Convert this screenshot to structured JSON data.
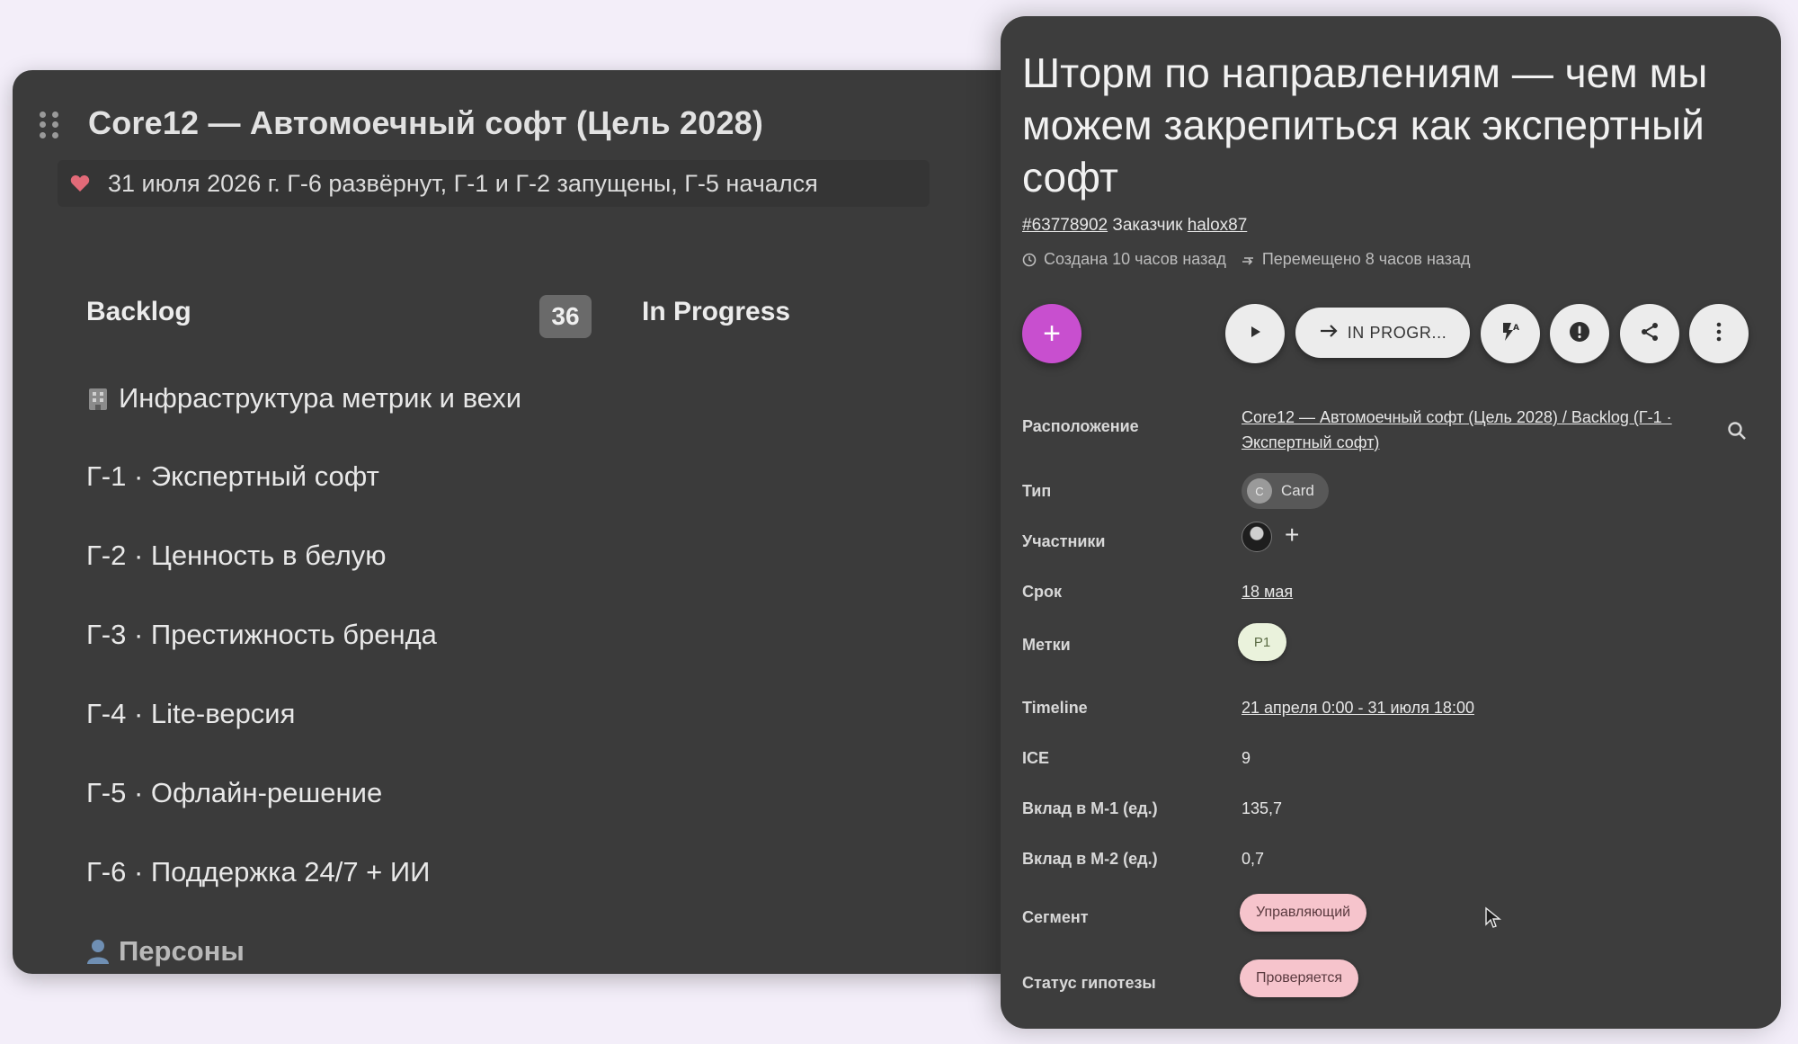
{
  "board": {
    "title": "Core12 — Автомоечный софт (Цель 2028)",
    "status_text": "31 июля 2026 г. Г-6 развёрнут, Г-1 и Г-2 запущены, Г-5 начался",
    "columns": [
      {
        "label": "Backlog",
        "count": "36"
      },
      {
        "label": "In Progress"
      }
    ],
    "items": [
      {
        "label": "Инфраструктура метрик и вехи",
        "icon": "building-icon"
      },
      {
        "label": "Г-1 · Экспертный софт"
      },
      {
        "label": "Г-2 · Ценность в белую"
      },
      {
        "label": "Г-3 · Престижность бренда"
      },
      {
        "label": "Г-4 · Lite-версия"
      },
      {
        "label": "Г-5 · Офлайн-решение"
      },
      {
        "label": "Г-6 · Поддержка 24/7 + ИИ"
      },
      {
        "label": "Персоны",
        "icon": "person-icon"
      }
    ]
  },
  "card": {
    "title": "Шторм по направлениям — чем мы можем закрепиться как экспертный софт",
    "id": "#63778902",
    "customer_label": "Заказчик",
    "customer": "halox87",
    "created": "Создана 10 часов назад",
    "moved": "Перемещено 8 часов назад",
    "actions": {
      "add": "+",
      "move_label": "IN PROGR...",
      "icons": [
        "play-icon",
        "arrow-right-icon",
        "flash-auto-icon",
        "alert-icon",
        "share-icon",
        "more-vertical-icon"
      ]
    },
    "properties": {
      "location_label": "Расположение",
      "location": "Core12 — Автомоечный софт (Цель 2028) / Backlog (Г-1 · Экспертный софт)",
      "type_label": "Тип",
      "type_avatar": "C",
      "type": "Card",
      "members_label": "Участники",
      "members_add": "+",
      "due_label": "Срок",
      "due": "18 мая",
      "tags_label": "Метки",
      "tag": "P1",
      "timeline_label": "Timeline",
      "timeline": "21 апреля 0:00 - 31 июля 18:00",
      "ice_label": "ICE",
      "ice": "9",
      "m1_label": "Вклад в М-1 (ед.)",
      "m1": "135,7",
      "m2_label": "Вклад в М-2 (ед.)",
      "m2": "0,7",
      "segment_label": "Сегмент",
      "segment": "Управляющий",
      "hypothesis_label": "Статус гипотезы",
      "hypothesis": "Проверяется"
    }
  },
  "colors": {
    "accent": "#c84fcf",
    "board_bg": "#3b3b3b",
    "panel_bg": "#3d3d3d",
    "page_bg": "#f3eef9",
    "tag_bg": "#eaf2dc",
    "pink_chip_bg": "#f6c4cc"
  }
}
